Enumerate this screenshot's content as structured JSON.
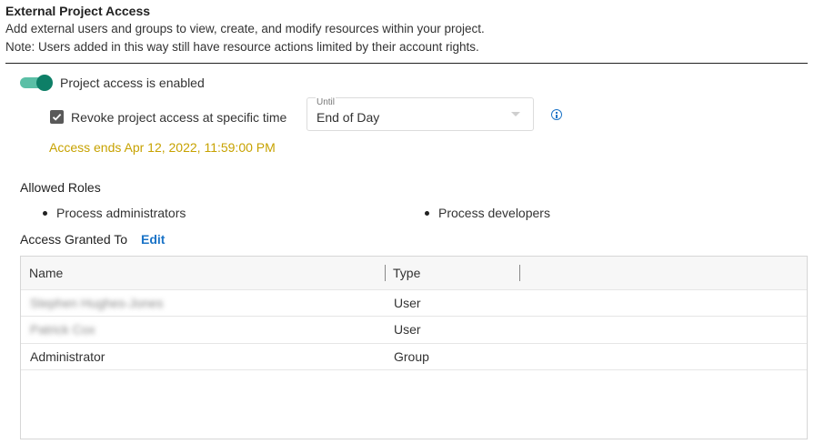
{
  "header": {
    "title": "External Project Access",
    "description_line1": "Add external users and groups to view, create, and modify resources within your project.",
    "description_line2": "Note: Users added in this way still have resource actions limited by their account rights."
  },
  "toggle": {
    "label": "Project access is enabled",
    "enabled": true
  },
  "revoke": {
    "label": "Revoke project access at specific time",
    "checked": true
  },
  "until": {
    "label": "Until",
    "value": "End of Day"
  },
  "access_ends": "Access ends Apr 12, 2022, 11:59:00 PM",
  "roles": {
    "title": "Allowed Roles",
    "items": [
      "Process administrators",
      "Process developers"
    ]
  },
  "granted": {
    "title": "Access Granted To",
    "edit_label": "Edit"
  },
  "table": {
    "columns": [
      "Name",
      "Type"
    ],
    "rows": [
      {
        "name": "Stephen Hughes-Jones",
        "type": "User"
      },
      {
        "name": "Patrick Cox",
        "type": "User"
      },
      {
        "name": "Administrator",
        "type": "Group"
      }
    ]
  },
  "colors": {
    "toggle_track": "#5bbfa6",
    "toggle_knob": "#0e7f67",
    "access_ends": "#c7a200",
    "link": "#1a73c7"
  },
  "icons": {
    "info": "info-circle-icon",
    "check": "checkmark-icon",
    "dropdown": "chevron-down-icon"
  }
}
